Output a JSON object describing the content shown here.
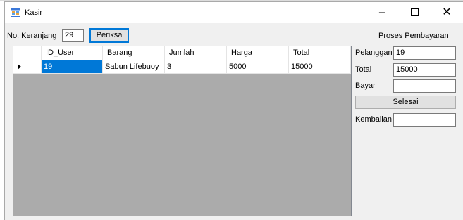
{
  "window": {
    "title": "Kasir",
    "icon": "app-form-icon"
  },
  "controls": {
    "minimize": "–",
    "close": "✕"
  },
  "cart": {
    "label": "No. Keranjang",
    "value": "29",
    "check_button": "Periksa"
  },
  "payment": {
    "heading": "Proses Pembayaran",
    "customer_label": "Pelanggan",
    "customer_value": "19",
    "total_label": "Total",
    "total_value": "15000",
    "pay_label": "Bayar",
    "pay_value": "",
    "finish_button": "Selesai",
    "change_label": "Kembalian",
    "change_value": ""
  },
  "grid": {
    "columns": [
      "ID_User",
      "Barang",
      "Jumlah",
      "Harga",
      "Total"
    ],
    "rows": [
      {
        "ID_User": "19",
        "Barang": "Sabun Lifebuoy",
        "Jumlah": "3",
        "Harga": "5000",
        "Total": "15000"
      }
    ]
  },
  "colors": {
    "selection": "#0078d7",
    "grid_background": "#ababab",
    "window_background": "#f0f0f0",
    "button_focus": "#0078d7"
  }
}
